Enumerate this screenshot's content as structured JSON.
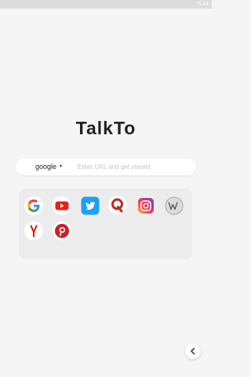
{
  "status_bar": {
    "time": "5:44"
  },
  "app": {
    "title": "TalkTo"
  },
  "search": {
    "engine": "google",
    "placeholder": "Enter URL and get started",
    "value": ""
  },
  "shortcuts": [
    {
      "name": "Google",
      "icon": "google-icon"
    },
    {
      "name": "YouTube",
      "icon": "youtube-icon"
    },
    {
      "name": "Twitter",
      "icon": "twitter-icon"
    },
    {
      "name": "Quora",
      "icon": "quora-icon"
    },
    {
      "name": "Instagram",
      "icon": "instagram-icon"
    },
    {
      "name": "Wikipedia",
      "icon": "wikipedia-icon"
    },
    {
      "name": "Yandex",
      "icon": "yandex-icon"
    },
    {
      "name": "Pinterest",
      "icon": "pinterest-icon"
    }
  ],
  "colors": {
    "background": "#f5f5f5",
    "youtube": "#e62117",
    "twitter": "#1da1f2",
    "quora": "#b92b27",
    "pinterest": "#cb2027",
    "yandex": "#e61400"
  }
}
